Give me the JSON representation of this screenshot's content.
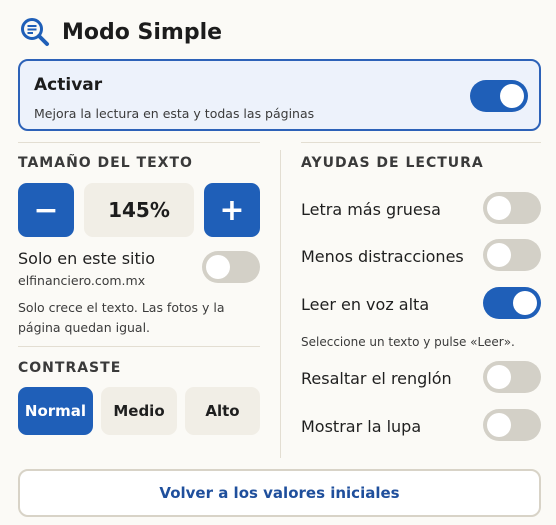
{
  "header": {
    "title": "Modo Simple",
    "icon": "magnifier-lines-icon"
  },
  "activate": {
    "title": "Activar",
    "subtitle": "Mejora la lectura en esta y todas las páginas",
    "enabled": true
  },
  "text_size": {
    "heading": "TAMAÑO DEL TEXTO",
    "decrease_label": "−",
    "increase_label": "+",
    "value": "145%",
    "site_only_label": "Solo en este sitio",
    "site_domain": "elfinanciero.com.mx",
    "site_only_enabled": false,
    "note": "Solo crece el texto. Las fotos y la página quedan igual."
  },
  "contrast": {
    "heading": "CONTRASTE",
    "options": [
      {
        "label": "Normal",
        "selected": true
      },
      {
        "label": "Medio",
        "selected": false
      },
      {
        "label": "Alto",
        "selected": false
      }
    ]
  },
  "reading_aids": {
    "heading": "AYUDAS DE LECTURA",
    "items": [
      {
        "label": "Letra más gruesa",
        "enabled": false
      },
      {
        "label": "Menos distracciones",
        "enabled": false
      },
      {
        "label": "Leer en voz alta",
        "enabled": true
      },
      {
        "label": "Resaltar el renglón",
        "enabled": false
      },
      {
        "label": "Mostrar la lupa",
        "enabled": false
      }
    ],
    "read_aloud_hint": "Seleccione un texto y pulse «Leer»."
  },
  "reset_label": "Volver a los valores iniciales",
  "colors": {
    "accent": "#1f5fb8",
    "panel_bg": "#fbfaf6",
    "toggle_off": "#d3d0c7",
    "chip_bg": "#f1eee6"
  }
}
